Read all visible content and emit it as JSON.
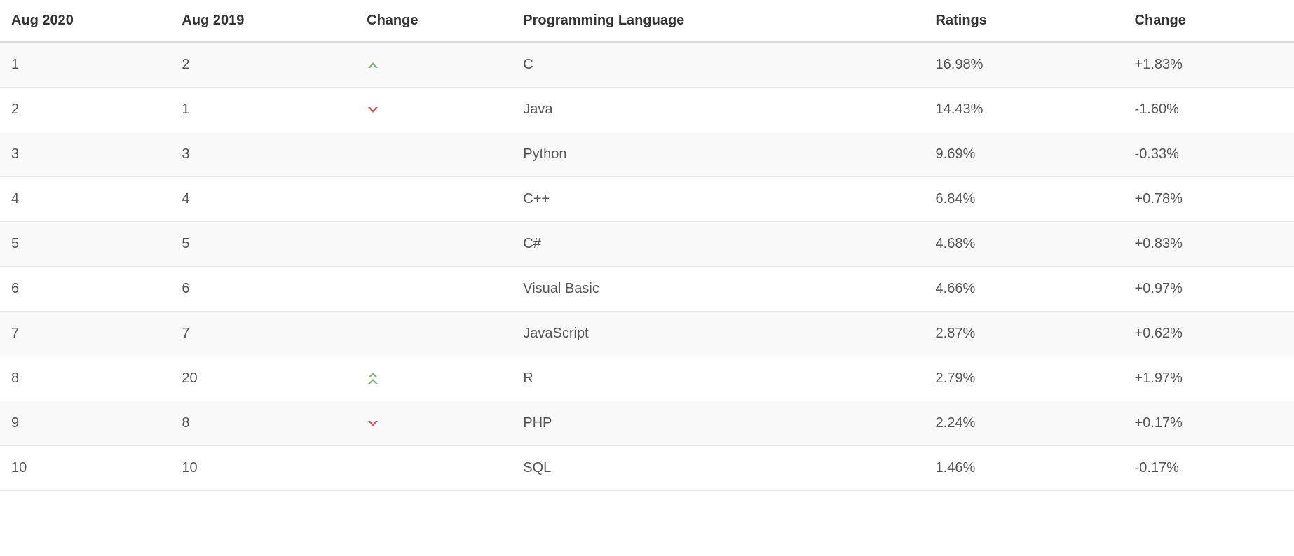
{
  "table": {
    "headers": {
      "aug2020": "Aug 2020",
      "aug2019": "Aug 2019",
      "change_icon": "Change",
      "language": "Programming Language",
      "ratings": "Ratings",
      "change": "Change"
    },
    "rows": [
      {
        "aug2020": "1",
        "aug2019": "2",
        "trend": "up",
        "language": "C",
        "ratings": "16.98%",
        "change": "+1.83%"
      },
      {
        "aug2020": "2",
        "aug2019": "1",
        "trend": "down",
        "language": "Java",
        "ratings": "14.43%",
        "change": "-1.60%"
      },
      {
        "aug2020": "3",
        "aug2019": "3",
        "trend": "none",
        "language": "Python",
        "ratings": "9.69%",
        "change": "-0.33%"
      },
      {
        "aug2020": "4",
        "aug2019": "4",
        "trend": "none",
        "language": "C++",
        "ratings": "6.84%",
        "change": "+0.78%"
      },
      {
        "aug2020": "5",
        "aug2019": "5",
        "trend": "none",
        "language": "C#",
        "ratings": "4.68%",
        "change": "+0.83%"
      },
      {
        "aug2020": "6",
        "aug2019": "6",
        "trend": "none",
        "language": "Visual Basic",
        "ratings": "4.66%",
        "change": "+0.97%"
      },
      {
        "aug2020": "7",
        "aug2019": "7",
        "trend": "none",
        "language": "JavaScript",
        "ratings": "2.87%",
        "change": "+0.62%"
      },
      {
        "aug2020": "8",
        "aug2019": "20",
        "trend": "double-up",
        "language": "R",
        "ratings": "2.79%",
        "change": "+1.97%"
      },
      {
        "aug2020": "9",
        "aug2019": "8",
        "trend": "down",
        "language": "PHP",
        "ratings": "2.24%",
        "change": "+0.17%"
      },
      {
        "aug2020": "10",
        "aug2019": "10",
        "trend": "none",
        "language": "SQL",
        "ratings": "1.46%",
        "change": "-0.17%"
      }
    ]
  },
  "chart_data": {
    "type": "table",
    "title": "Programming Language Rankings Aug 2020 vs Aug 2019",
    "columns": [
      "Aug 2020",
      "Aug 2019",
      "Change",
      "Programming Language",
      "Ratings",
      "Change"
    ],
    "data": [
      [
        1,
        2,
        "up",
        "C",
        16.98,
        1.83
      ],
      [
        2,
        1,
        "down",
        "Java",
        14.43,
        -1.6
      ],
      [
        3,
        3,
        "none",
        "Python",
        9.69,
        -0.33
      ],
      [
        4,
        4,
        "none",
        "C++",
        6.84,
        0.78
      ],
      [
        5,
        5,
        "none",
        "C#",
        4.68,
        0.83
      ],
      [
        6,
        6,
        "none",
        "Visual Basic",
        4.66,
        0.97
      ],
      [
        7,
        7,
        "none",
        "JavaScript",
        2.87,
        0.62
      ],
      [
        8,
        20,
        "double-up",
        "R",
        2.79,
        1.97
      ],
      [
        9,
        8,
        "down",
        "PHP",
        2.24,
        0.17
      ],
      [
        10,
        10,
        "none",
        "SQL",
        1.46,
        -0.17
      ]
    ]
  }
}
